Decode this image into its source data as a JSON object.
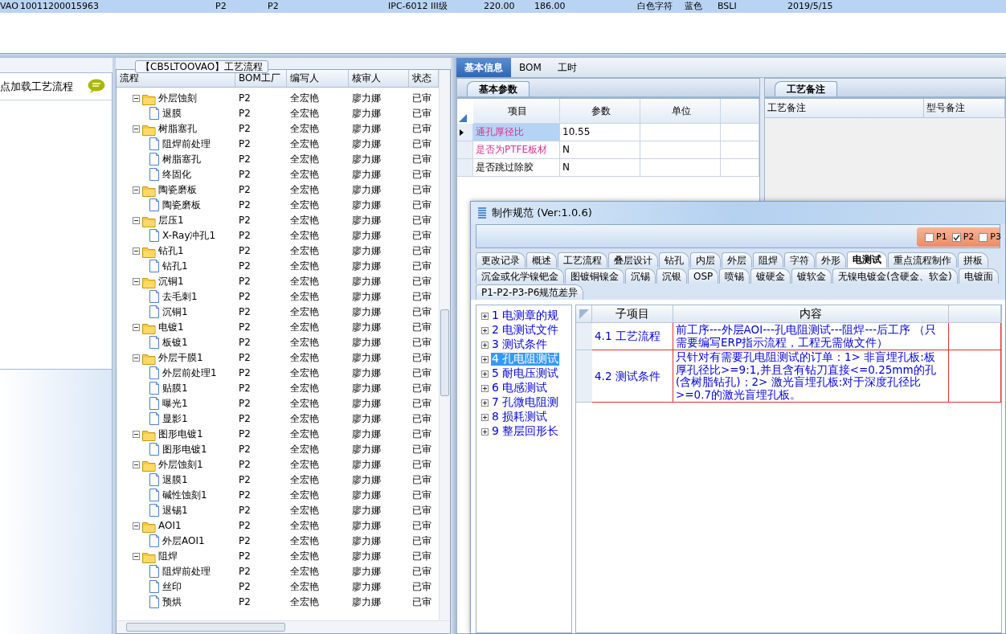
{
  "top_row": {
    "selected": true,
    "cells": [
      "VAO",
      "10011200015963",
      "P2",
      "P2",
      "IPC-6012 III级",
      "220.00",
      "186.00",
      "白色字符",
      "蓝色",
      "BSLI",
      "2019/5/15"
    ]
  },
  "left_pane": {
    "load_label": "点加载工艺流程"
  },
  "process_panel": {
    "title": "【CB5LTOOVAO】工艺流程",
    "columns": [
      "流程",
      "BOM工厂",
      "编写人",
      "核审人",
      "状态"
    ],
    "rows": [
      {
        "name": "外层蚀刻",
        "expanded": true,
        "bom": "P2",
        "writer": "全宏艳",
        "reviewer": "廖力娜",
        "status": "已审",
        "children": [
          {
            "name": "退膜",
            "bom": "P2",
            "writer": "全宏艳",
            "reviewer": "廖力娜",
            "status": "已审"
          }
        ]
      },
      {
        "name": "树脂塞孔",
        "expanded": true,
        "bom": "P2",
        "writer": "全宏艳",
        "reviewer": "廖力娜",
        "status": "已审",
        "children": [
          {
            "name": "阻焊前处理",
            "bom": "P2",
            "writer": "全宏艳",
            "reviewer": "廖力娜",
            "status": "已审"
          },
          {
            "name": "树脂塞孔",
            "bom": "P2",
            "writer": "全宏艳",
            "reviewer": "廖力娜",
            "status": "已审"
          },
          {
            "name": "终固化",
            "bom": "P2",
            "writer": "全宏艳",
            "reviewer": "廖力娜",
            "status": "已审"
          }
        ]
      },
      {
        "name": "陶瓷磨板",
        "expanded": true,
        "bom": "P2",
        "writer": "全宏艳",
        "reviewer": "廖力娜",
        "status": "已审",
        "children": [
          {
            "name": "陶瓷磨板",
            "bom": "P2",
            "writer": "全宏艳",
            "reviewer": "廖力娜",
            "status": "已审"
          }
        ]
      },
      {
        "name": "层压1",
        "expanded": true,
        "bom": "P2",
        "writer": "全宏艳",
        "reviewer": "廖力娜",
        "status": "已审",
        "children": [
          {
            "name": "X-Ray冲孔1",
            "bom": "P2",
            "writer": "全宏艳",
            "reviewer": "廖力娜",
            "status": "已审"
          }
        ]
      },
      {
        "name": "钻孔1",
        "expanded": true,
        "bom": "P2",
        "writer": "全宏艳",
        "reviewer": "廖力娜",
        "status": "已审",
        "children": [
          {
            "name": "钻孔1",
            "bom": "P2",
            "writer": "全宏艳",
            "reviewer": "廖力娜",
            "status": "已审"
          }
        ]
      },
      {
        "name": "沉铜1",
        "expanded": true,
        "bom": "P2",
        "writer": "全宏艳",
        "reviewer": "廖力娜",
        "status": "已审",
        "children": [
          {
            "name": "去毛刺1",
            "bom": "P2",
            "writer": "全宏艳",
            "reviewer": "廖力娜",
            "status": "已审"
          },
          {
            "name": "沉铜1",
            "bom": "P2",
            "writer": "全宏艳",
            "reviewer": "廖力娜",
            "status": "已审"
          }
        ]
      },
      {
        "name": "电镀1",
        "expanded": true,
        "bom": "P2",
        "writer": "全宏艳",
        "reviewer": "廖力娜",
        "status": "已审",
        "children": [
          {
            "name": "板镀1",
            "bom": "P2",
            "writer": "全宏艳",
            "reviewer": "廖力娜",
            "status": "已审"
          }
        ]
      },
      {
        "name": "外层干膜1",
        "expanded": true,
        "bom": "P2",
        "writer": "全宏艳",
        "reviewer": "廖力娜",
        "status": "已审",
        "children": [
          {
            "name": "外层前处理1",
            "bom": "P2",
            "writer": "全宏艳",
            "reviewer": "廖力娜",
            "status": "已审"
          },
          {
            "name": "贴膜1",
            "bom": "P2",
            "writer": "全宏艳",
            "reviewer": "廖力娜",
            "status": "已审"
          },
          {
            "name": "曝光1",
            "bom": "P2",
            "writer": "全宏艳",
            "reviewer": "廖力娜",
            "status": "已审"
          },
          {
            "name": "显影1",
            "bom": "P2",
            "writer": "全宏艳",
            "reviewer": "廖力娜",
            "status": "已审"
          }
        ]
      },
      {
        "name": "图形电镀1",
        "expanded": true,
        "bom": "P2",
        "writer": "全宏艳",
        "reviewer": "廖力娜",
        "status": "已审",
        "children": [
          {
            "name": "图形电镀1",
            "bom": "P2",
            "writer": "全宏艳",
            "reviewer": "廖力娜",
            "status": "已审"
          }
        ]
      },
      {
        "name": "外层蚀刻1",
        "expanded": true,
        "bom": "P2",
        "writer": "全宏艳",
        "reviewer": "廖力娜",
        "status": "已审",
        "children": [
          {
            "name": "退膜1",
            "bom": "P2",
            "writer": "全宏艳",
            "reviewer": "廖力娜",
            "status": "已审"
          },
          {
            "name": "碱性蚀刻1",
            "bom": "P2",
            "writer": "全宏艳",
            "reviewer": "廖力娜",
            "status": "已审"
          },
          {
            "name": "退锡1",
            "bom": "P2",
            "writer": "全宏艳",
            "reviewer": "廖力娜",
            "status": "已审"
          }
        ]
      },
      {
        "name": "AOI1",
        "expanded": true,
        "bom": "P2",
        "writer": "全宏艳",
        "reviewer": "廖力娜",
        "status": "已审",
        "children": [
          {
            "name": "外层AOI1",
            "bom": "P2",
            "writer": "全宏艳",
            "reviewer": "廖力娜",
            "status": "已审"
          }
        ]
      },
      {
        "name": "阻焊",
        "expanded": true,
        "bom": "P2",
        "writer": "全宏艳",
        "reviewer": "廖力娜",
        "status": "已审",
        "children": [
          {
            "name": "阻焊前处理",
            "bom": "P2",
            "writer": "全宏艳",
            "reviewer": "廖力娜",
            "status": "已审"
          },
          {
            "name": "丝印",
            "bom": "P2",
            "writer": "全宏艳",
            "reviewer": "廖力娜",
            "status": "已审"
          },
          {
            "name": "预烘",
            "bom": "P2",
            "writer": "全宏艳",
            "reviewer": "廖力娜",
            "status": "已审"
          }
        ]
      }
    ]
  },
  "right_tabs": [
    {
      "label": "基本信息",
      "selected": true
    },
    {
      "label": "BOM",
      "selected": false
    },
    {
      "label": "工时",
      "selected": false
    }
  ],
  "params": {
    "tab": "基本参数",
    "columns": [
      "项目",
      "参数",
      "单位"
    ],
    "rows": [
      {
        "item": "通孔厚径比",
        "value": "10.55",
        "highlighted": true,
        "current": true
      },
      {
        "item": "是否为PTFE板材",
        "value": "N",
        "highlighted": true,
        "current": false
      },
      {
        "item": "是否跳过除胶",
        "value": "N",
        "highlighted": false,
        "current": false
      }
    ]
  },
  "notes": {
    "tab": "工艺备注",
    "columns": [
      "工艺备注",
      "型号备注"
    ]
  },
  "spec_window": {
    "title": "制作规范 (Ver:1.0.6)",
    "plants": [
      {
        "label": "P1",
        "checked": false
      },
      {
        "label": "P2",
        "checked": true
      },
      {
        "label": "P3",
        "checked": false
      }
    ],
    "tab_rows": [
      [
        {
          "label": "更改记录",
          "selected": false
        },
        {
          "label": "概述",
          "selected": false
        },
        {
          "label": "工艺流程",
          "selected": false
        },
        {
          "label": "叠层设计",
          "selected": false
        },
        {
          "label": "钻孔",
          "selected": false
        },
        {
          "label": "内层",
          "selected": false
        },
        {
          "label": "外层",
          "selected": false
        },
        {
          "label": "阻焊",
          "selected": false
        },
        {
          "label": "字符",
          "selected": false
        },
        {
          "label": "外形",
          "selected": false
        },
        {
          "label": "电测试",
          "selected": true
        },
        {
          "label": "重点流程制作",
          "selected": false
        },
        {
          "label": "拼板",
          "selected": false
        }
      ],
      [
        {
          "label": "沉金或化学镍钯金",
          "selected": false
        },
        {
          "label": "图镀铜镍金",
          "selected": false
        },
        {
          "label": "沉锡",
          "selected": false
        },
        {
          "label": "沉银",
          "selected": false
        },
        {
          "label": "OSP",
          "selected": false
        },
        {
          "label": "喷锡",
          "selected": false
        },
        {
          "label": "镀硬金",
          "selected": false
        },
        {
          "label": "镀软金",
          "selected": false
        },
        {
          "label": "无镍电镀金(含硬金、软金)",
          "selected": false
        },
        {
          "label": "电镀面",
          "selected": false
        }
      ],
      [
        {
          "label": "P1-P2-P3-P6规范差异",
          "selected": false
        }
      ]
    ],
    "sections": [
      {
        "number": "1",
        "label": "电测章的规",
        "expanded": false,
        "selected": false
      },
      {
        "number": "2",
        "label": "电测试文件",
        "expanded": false,
        "selected": false
      },
      {
        "number": "3",
        "label": "测试条件",
        "expanded": false,
        "selected": false
      },
      {
        "number": "4",
        "label": "孔电阻测试",
        "expanded": false,
        "selected": true
      },
      {
        "number": "5",
        "label": "耐电压测试",
        "expanded": false,
        "selected": false
      },
      {
        "number": "6",
        "label": "电感测试",
        "expanded": false,
        "selected": false
      },
      {
        "number": "7",
        "label": "孔微电阻测",
        "expanded": false,
        "selected": false
      },
      {
        "number": "8",
        "label": "损耗测试",
        "expanded": false,
        "selected": false
      },
      {
        "number": "9",
        "label": "整层回形长",
        "expanded": false,
        "selected": false
      }
    ],
    "grid": {
      "columns": [
        "子项目",
        "内容"
      ],
      "rows": [
        {
          "item": "4.1 工艺流程",
          "content": "前工序---外层AOI---孔电阻测试---阻焊---后工序 （只需要编写ERP指示流程，工程无需做文件）"
        },
        {
          "item": "4.2 测试条件",
          "content": "只针对有需要孔电阻测试的订单：1> 非盲埋孔板:板厚孔径比>=9:1,并且含有钻刀直接<=0.25mm的孔(含树脂钻孔)；2> 激光盲埋孔板:对于深度孔径比>=0.7的激光盲埋孔板。"
        }
      ]
    }
  }
}
